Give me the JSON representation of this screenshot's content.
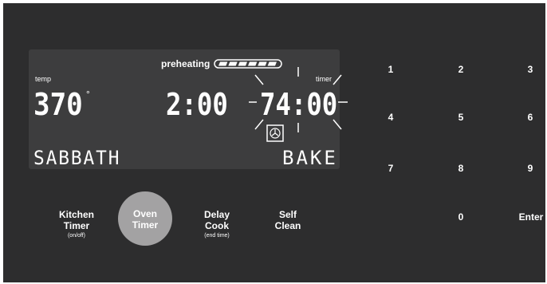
{
  "display": {
    "preheating_label": "preheating",
    "temp_label": "temp",
    "temp_value": "370",
    "temp_unit": "°",
    "clock_value": "2:00",
    "timer_label": "timer",
    "timer_value": "74:00",
    "mode_left": "SABBATH",
    "mode_right": "BAKE",
    "preheat_progress_segments_lit": 6,
    "preheat_progress_segments_total": 6
  },
  "buttons": {
    "kitchen_timer": {
      "line1": "Kitchen",
      "line2": "Timer",
      "sub": "(on/off)"
    },
    "oven_timer": {
      "line1": "Oven",
      "line2": "Timer"
    },
    "delay_cook": {
      "line1": "Delay",
      "line2": "Cook",
      "sub": "(end time)"
    },
    "self_clean": {
      "line1": "Self",
      "line2": "Clean"
    }
  },
  "keypad": {
    "k1": "1",
    "k2": "2",
    "k3": "3",
    "k4": "4",
    "k5": "5",
    "k6": "6",
    "k7": "7",
    "k8": "8",
    "k9": "9",
    "k0": "0",
    "enter": "Enter"
  },
  "colors": {
    "panel": "#2d2d2e",
    "display": "#3d3d3e",
    "highlight_button": "#a3a2a3",
    "text": "#ffffff"
  }
}
